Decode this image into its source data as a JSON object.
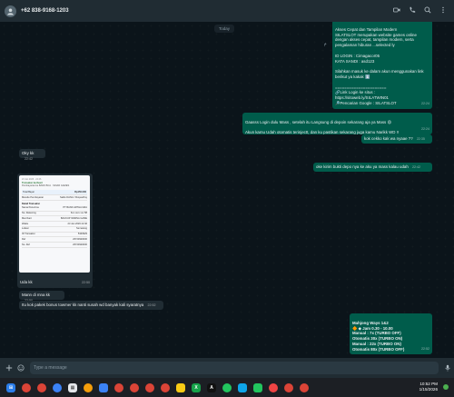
{
  "header": {
    "contact": "+62 838-9168-1203",
    "icons": [
      "video-call-icon",
      "voice-call-icon",
      "search-icon",
      "menu-icon"
    ]
  },
  "chat": {
    "day_label": "Today",
    "messages": [
      {
        "id": "m1",
        "dir": "out",
        "text": "Akses Cepat dan Tampilan Modern\nSILATSLOT merupakan website games online dengan akses cepat, tampilan modern, serta pengalaman hiburan ...selected ly\n\nID LOGIN : Cimagacor05\nKATA SANDI : asd123\n\nSilahkan masuk ke dalam akun menggunakan link berikut ya kakak ⬇️\n\n======================\n🔗Link Login ke situs :\nhttps://sitoweb.ly/SILATWIN01\n🔎Pencarian Google : SILATSLOT",
        "time": "22:24"
      },
      {
        "id": "m2",
        "dir": "out",
        "text": "Gaasss Login dulu Mass , setelah itu Langsung di depoin sekarang aja ya Mass 😄\n\nAkun kamu Udah otomatis terinjectt, dan ku pastikan sekarang juga kamu Narikk WD !!",
        "time": "22:24"
      },
      {
        "id": "m3",
        "dir": "out",
        "text": "kok cekko kak wa nyaae ??",
        "time": "22:35"
      },
      {
        "id": "m4",
        "dir": "in",
        "text": "Oky kk",
        "time": "22:42"
      },
      {
        "id": "m5",
        "dir": "out",
        "text": "oke kirim bukti depo nya ke aku ya mass kalau udah",
        "time": "22:42"
      },
      {
        "id": "m6",
        "dir": "in",
        "text": "Uda kk",
        "time": "22:50"
      },
      {
        "id": "m7",
        "dir": "in",
        "text": "Mann di mna kk",
        "time": "22:50"
      },
      {
        "id": "m8",
        "dir": "in",
        "text": "Itu kok pakek bonus towmer kk nanti susah wd banyak kali syaratnya",
        "time": "22:52"
      },
      {
        "id": "m9",
        "dir": "out",
        "text": "Mahjong Ways 1&2\n🔶 ◆ Jam 0.30 - 10.00\nManual :   7x (TURBO OFF)\nOtomatis 30x (TURBO ON)\nManual :  22x (TURBO ON)\nOtomatis 80x (TURBO OFF)",
        "time": "22:52"
      }
    ],
    "receipt": {
      "date": "23 Jan 2026 · 22:46",
      "status": "Transaksi berhasil",
      "bank": "Pembayaran ke BANK BCA · SINAR GAMES",
      "total_label": "Total Bayar",
      "total_value": "Rp150.000",
      "method_label": "Metode Pembayaran",
      "method_value": "Saldo DANA / ShopeePay",
      "section": "Detail Transaksi",
      "rows": [
        {
          "k": "Nama Penerima",
          "v": "PT BANK ARTHA GRA"
        },
        {
          "k": "No. Rekening",
          "v": "6xx xxxx xxx 58"
        },
        {
          "k": "Merchant",
          "v": "BACKUP WARNA GAME"
        },
        {
          "k": "Waktu",
          "v": "23 Jan 2026 22:46"
        },
        {
          "k": "Lokasi",
          "v": "Semarang"
        },
        {
          "k": "ID Transaksi",
          "v": "5340929"
        },
        {
          "k": "Ref",
          "v": "26723920000"
        },
        {
          "k": "No. Ref",
          "v": "26723920000"
        }
      ]
    }
  },
  "composer": {
    "placeholder": "Type a message"
  },
  "taskbar": {
    "time": "10:52 PM",
    "date": "1/15/2026"
  },
  "colors": {
    "out_bubble": "#005c4b",
    "in_bubble": "#202c33",
    "chat_bg": "#0b141a",
    "header": "#202c33"
  }
}
